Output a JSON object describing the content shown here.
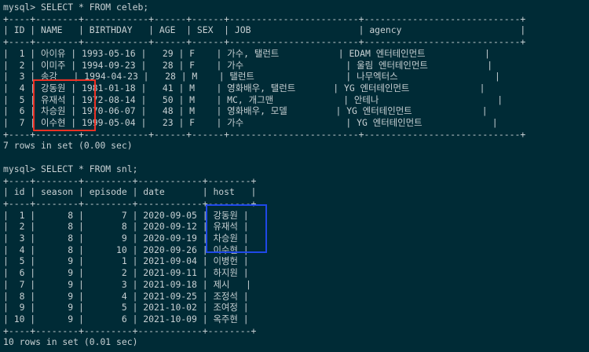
{
  "terminal": {
    "lines": [
      "mysql> SELECT * FROM celeb;",
      "+----+--------+------------+------+------+------------------------+-----------------------------+",
      "| ID | NAME   | BIRTHDAY   | AGE  | SEX  | JOB                    | agency                      |",
      "+----+--------+------------+------+------+------------------------+-----------------------------+",
      "|  1 | 아이유 | 1993-05-16 |   29 | F    | 가수, 탤런트           | EDAM 엔터테인먼트           |",
      "|  2 | 이미주 | 1994-09-23 |   28 | F    | 가수                   | 울림 엔터테인먼트           |",
      "|  3 | 송강   | 1994-04-23 |   28 | M    | 탤런트                 | 나무엑터스                  |",
      "|  4 | 강동원 | 1981-01-18 |   41 | M    | 영화배우, 탤런트       | YG 엔터테인먼트             |",
      "|  5 | 유재석 | 1972-08-14 |   50 | M    | MC, 개그맨             | 안테나                      |",
      "|  6 | 차승원 | 1970-06-07 |   48 | M    | 영화배우, 모델         | YG 엔터테인먼트             |",
      "|  7 | 이수현 | 1999-05-04 |   23 | F    | 가수                   | YG 엔터테인먼트             |",
      "+----+--------+------------+------+------+------------------------+-----------------------------+",
      "7 rows in set (0.00 sec)",
      "",
      "mysql> SELECT * FROM snl;",
      "+----+--------+---------+------------+--------+",
      "| id | season | episode | date       | host   |",
      "+----+--------+---------+------------+--------+",
      "|  1 |      8 |       7 | 2020-09-05 | 강동원 |",
      "|  2 |      8 |       8 | 2020-09-12 | 유재석 |",
      "|  3 |      8 |       9 | 2020-09-19 | 차승원 |",
      "|  4 |      8 |      10 | 2020-09-26 | 이수현 |",
      "|  5 |      9 |       1 | 2021-09-04 | 이병헌 |",
      "|  6 |      9 |       2 | 2021-09-11 | 하지원 |",
      "|  7 |      9 |       3 | 2021-09-18 | 제시   |",
      "|  8 |      9 |       4 | 2021-09-25 | 조정석 |",
      "|  9 |      9 |       5 | 2021-10-02 | 조여정 |",
      "| 10 |      9 |       6 | 2021-10-09 | 옥주현 |",
      "+----+--------+---------+------------+--------+",
      "10 rows in set (0.01 sec)"
    ]
  },
  "colors": {
    "background": "#002b36",
    "text": "#c7d0d3",
    "celeb_highlight": "#ee3124",
    "host_highlight": "#1f48e8"
  }
}
